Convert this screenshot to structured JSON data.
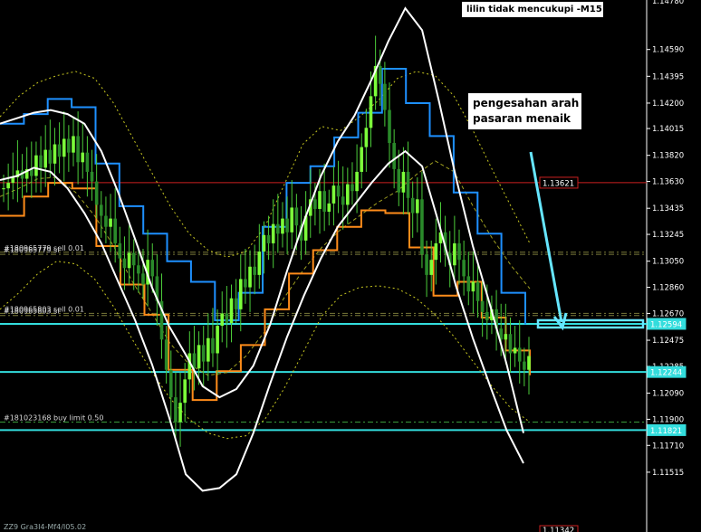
{
  "chart_data": {
    "type": "candlestick",
    "title": "lilin tidak mencukupi -M15",
    "annotation": "pengesahan arah\npasaran menaik",
    "symbol": "ZZ9 Gra3I4-Mf4/I05.02",
    "ylim": [
      1.1108,
      1.1495
    ],
    "y_ticks": [
      1.1459,
      1.14395,
      1.142,
      1.14015,
      1.1382,
      1.1363,
      1.13435,
      1.13245,
      1.1305,
      1.1286,
      1.1267,
      1.12475,
      1.12285,
      1.1209,
      1.119,
      1.1171,
      1.11515
    ],
    "top_price": "1.14780",
    "bottom_price": "1.11342",
    "price_markers": [
      {
        "label": "1.13621",
        "value": 1.13621,
        "color": "#cc2020"
      },
      {
        "label": "1.12594",
        "value": 1.12594,
        "color": "#33dddd"
      },
      {
        "label": "1.12244",
        "value": 1.12244,
        "color": "#33dddd"
      },
      {
        "label": "1.11821",
        "value": 1.11821,
        "color": "#33dddd"
      }
    ],
    "orders": [
      {
        "label": "#180965779 sell 0.01",
        "value": 1.13115
      },
      {
        "label": "#180965779 sl",
        "value": 1.131
      },
      {
        "label": "#180965803 sell 0.01",
        "value": 1.1267
      },
      {
        "label": "#180965803 sl",
        "value": 1.12655
      },
      {
        "label": "#181023168 buy limit 0.50",
        "value": 1.1188
      }
    ],
    "series": {
      "close": [
        1.1358,
        1.1362,
        1.1366,
        1.1371,
        1.1365,
        1.1372,
        1.1367,
        1.1382,
        1.1373,
        1.1386,
        1.1376,
        1.139,
        1.1381,
        1.1394,
        1.1384,
        1.1396,
        1.1377,
        1.1384,
        1.137,
        1.1363,
        1.1346,
        1.1338,
        1.133,
        1.1336,
        1.1318,
        1.1307,
        1.13,
        1.1311,
        1.1302,
        1.1296,
        1.1288,
        1.1306,
        1.1294,
        1.1276,
        1.1248,
        1.1226,
        1.1206,
        1.1188,
        1.1202,
        1.1219,
        1.1238,
        1.1227,
        1.1244,
        1.1232,
        1.1249,
        1.1238,
        1.1258,
        1.1267,
        1.126,
        1.1278,
        1.127,
        1.1292,
        1.1286,
        1.1301,
        1.1295,
        1.1312,
        1.1324,
        1.1318,
        1.1332,
        1.1325,
        1.1336,
        1.1326,
        1.1344,
        1.1331,
        1.132,
        1.1338,
        1.135,
        1.1343,
        1.1356,
        1.1341,
        1.1347,
        1.136,
        1.1352,
        1.1346,
        1.1361,
        1.1356,
        1.137,
        1.1388,
        1.1402,
        1.1425,
        1.1447,
        1.1434,
        1.1415,
        1.1391,
        1.1372,
        1.1355,
        1.137,
        1.1351,
        1.134,
        1.135,
        1.131,
        1.1295,
        1.1306,
        1.1318,
        1.1326,
        1.1311,
        1.1302,
        1.1318,
        1.1306,
        1.1294,
        1.1283,
        1.129,
        1.1276,
        1.1268,
        1.1262,
        1.127,
        1.1256,
        1.1248,
        1.1252,
        1.1238,
        1.1242,
        1.1232,
        1.1226,
        1.1236
      ],
      "bands_upper": [
        1.1405,
        1.1409,
        1.1413,
        1.1415,
        1.1412,
        1.1405,
        1.1385,
        1.1355,
        1.1321,
        1.1286,
        1.1258,
        1.1237,
        1.1214,
        1.1206,
        1.1212,
        1.1229,
        1.1259,
        1.1298,
        1.1334,
        1.1367,
        1.1392,
        1.1411,
        1.1437,
        1.1465,
        1.1489,
        1.1473,
        1.1421,
        1.1366,
        1.1316,
        1.1274,
        1.123,
        1.118
      ],
      "bands_lower": [
        1.1364,
        1.1367,
        1.1373,
        1.137,
        1.1358,
        1.134,
        1.1318,
        1.129,
        1.1262,
        1.123,
        1.1192,
        1.115,
        1.1138,
        1.114,
        1.115,
        1.118,
        1.1216,
        1.125,
        1.128,
        1.1307,
        1.133,
        1.1346,
        1.1362,
        1.1376,
        1.1385,
        1.1374,
        1.1332,
        1.1287,
        1.1249,
        1.1215,
        1.1182,
        1.1158
      ],
      "outer_upper": [
        1.141,
        1.1425,
        1.1435,
        1.144,
        1.1443,
        1.1438,
        1.142,
        1.1395,
        1.137,
        1.1345,
        1.1325,
        1.1313,
        1.1308,
        1.1312,
        1.133,
        1.136,
        1.139,
        1.1403,
        1.14,
        1.141,
        1.1422,
        1.1438,
        1.1443,
        1.144,
        1.1425,
        1.14,
        1.1372,
        1.1345,
        1.1318
      ],
      "outer_lower": [
        1.127,
        1.1282,
        1.1296,
        1.1305,
        1.1303,
        1.1292,
        1.1272,
        1.1248,
        1.1225,
        1.1205,
        1.119,
        1.118,
        1.1176,
        1.1178,
        1.119,
        1.1212,
        1.1238,
        1.1265,
        1.128,
        1.1286,
        1.1287,
        1.1285,
        1.1278,
        1.1266,
        1.125,
        1.1232,
        1.1214,
        1.1198,
        1.1188
      ],
      "middle": [
        1.1352,
        1.1358,
        1.1365,
        1.1366,
        1.1355,
        1.1338,
        1.1316,
        1.129,
        1.1268,
        1.1245,
        1.123,
        1.1222,
        1.1224,
        1.1236,
        1.1254,
        1.1278,
        1.1298,
        1.1315,
        1.1328,
        1.1338,
        1.1348,
        1.1356,
        1.1368,
        1.1378,
        1.137,
        1.1345,
        1.1322,
        1.1302,
        1.1285
      ],
      "blue_upper": [
        1.1405,
        1.1405,
        1.1412,
        1.1412,
        1.1423,
        1.1423,
        1.1417,
        1.1417,
        1.1376,
        1.1376,
        1.1345,
        1.1345,
        1.1325,
        1.1325,
        1.1305,
        1.1305,
        1.129,
        1.129,
        1.1262,
        1.1262,
        1.1282,
        1.1282,
        1.133,
        1.133,
        1.1362,
        1.1362,
        1.1374,
        1.1374,
        1.1395,
        1.1395,
        1.1413,
        1.1413,
        1.1445,
        1.1445,
        1.142,
        1.142,
        1.1396,
        1.1396,
        1.1355,
        1.1355,
        1.1325,
        1.1325,
        1.1282,
        1.1282,
        1.1259
      ],
      "orange_lower": [
        1.1338,
        1.1338,
        1.1352,
        1.1352,
        1.1362,
        1.1362,
        1.1358,
        1.1358,
        1.1316,
        1.1316,
        1.1288,
        1.1288,
        1.1266,
        1.1266,
        1.1226,
        1.1226,
        1.1204,
        1.1204,
        1.1225,
        1.1225,
        1.1244,
        1.1244,
        1.127,
        1.127,
        1.1296,
        1.1296,
        1.1313,
        1.1313,
        1.133,
        1.133,
        1.1342,
        1.1342,
        1.134,
        1.134,
        1.1315,
        1.1315,
        1.128,
        1.128,
        1.129,
        1.129,
        1.1264,
        1.1264,
        1.124,
        1.124,
        1.1222
      ]
    }
  }
}
